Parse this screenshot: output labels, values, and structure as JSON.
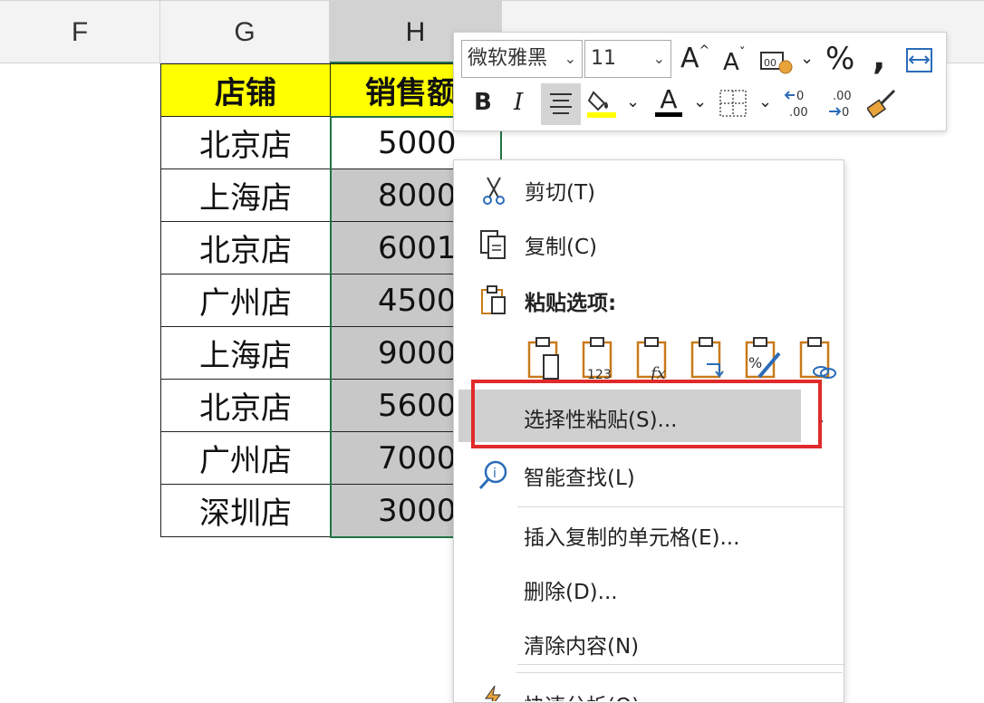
{
  "columns": [
    "F",
    "G",
    "H"
  ],
  "table": {
    "headers": [
      "店铺",
      "销售额"
    ],
    "rows": [
      [
        "北京店",
        "5000"
      ],
      [
        "上海店",
        "8000"
      ],
      [
        "北京店",
        "6001"
      ],
      [
        "广州店",
        "4500"
      ],
      [
        "上海店",
        "9000"
      ],
      [
        "北京店",
        "5600"
      ],
      [
        "广州店",
        "7000"
      ],
      [
        "深圳店",
        "3000"
      ]
    ]
  },
  "mini_toolbar": {
    "font_name": "微软雅黑",
    "font_size": "11",
    "bold": "B",
    "italic": "I",
    "percent": "%",
    "comma": "❟",
    "increase_font": "A",
    "decrease_font": "A",
    "font_color_letter": "A"
  },
  "menu": {
    "cut": "剪切(T)",
    "copy": "复制(C)",
    "paste_options": "粘贴选项:",
    "paste_special": "选择性粘贴(S)...",
    "smart_lookup": "智能查找(L)",
    "insert_copied": "插入复制的单元格(E)...",
    "delete": "删除(D)...",
    "clear": "清除内容(N)",
    "quick_analysis": "快速分析(Q)"
  },
  "colors": {
    "header_fill": "#ffff00",
    "selection_border": "#217346",
    "highlight_box": "#e12a2a"
  }
}
